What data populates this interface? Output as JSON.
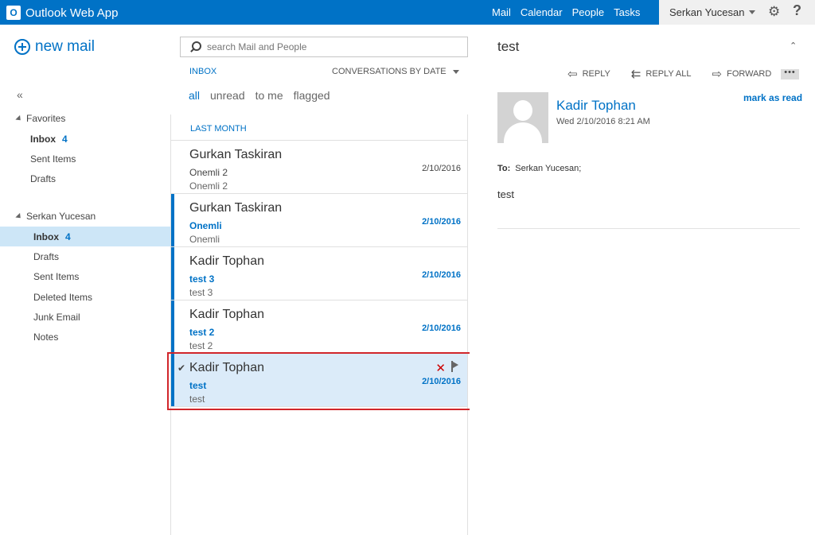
{
  "app": {
    "title": "Outlook Web App",
    "logo_letter": "O"
  },
  "topnav": {
    "items": [
      "Mail",
      "Calendar",
      "People",
      "Tasks"
    ]
  },
  "user": {
    "name": "Serkan Yucesan",
    "settings_icon": "gear-icon",
    "help_label": "?"
  },
  "leftnav": {
    "new_mail": "new mail",
    "collapse": "«",
    "favorites": {
      "title": "Favorites",
      "inbox_label": "Inbox",
      "inbox_count": "4",
      "sent": "Sent Items",
      "drafts": "Drafts"
    },
    "account": {
      "title": "Serkan Yucesan",
      "inbox_label": "Inbox",
      "inbox_count": "4",
      "drafts": "Drafts",
      "sent": "Sent Items",
      "deleted": "Deleted Items",
      "junk": "Junk Email",
      "notes": "Notes"
    }
  },
  "list": {
    "search_placeholder": "search Mail and People",
    "folder": "INBOX",
    "sort": "CONVERSATIONS BY DATE",
    "filters": [
      "all",
      "unread",
      "to me",
      "flagged"
    ],
    "group": "LAST MONTH",
    "messages": [
      {
        "from": "Gurkan Taskiran",
        "subject": "Onemli 2",
        "preview": "Onemli 2",
        "date": "2/10/2016"
      },
      {
        "from": "Gurkan Taskiran",
        "subject": "Onemli",
        "preview": "Onemli",
        "date": "2/10/2016"
      },
      {
        "from": "Kadir Tophan",
        "subject": "test 3",
        "preview": "test 3",
        "date": "2/10/2016"
      },
      {
        "from": "Kadir Tophan",
        "subject": "test 2",
        "preview": "test 2",
        "date": "2/10/2016"
      },
      {
        "from": "Kadir Tophan",
        "subject": "test",
        "preview": "test",
        "date": "2/10/2016"
      }
    ]
  },
  "reading": {
    "subject": "test",
    "reply": "REPLY",
    "reply_all": "REPLY ALL",
    "forward": "FORWARD",
    "more": "•••",
    "sender": "Kadir Tophan",
    "date": "Wed 2/10/2016 8:21 AM",
    "mark_read": "mark as read",
    "to_label": "To:",
    "to_value": "Serkan Yucesan;",
    "body": "test"
  },
  "colors": {
    "accent": "#0072c6",
    "selected_bg": "#dbebf9",
    "highlight_border": "#d1262b"
  }
}
